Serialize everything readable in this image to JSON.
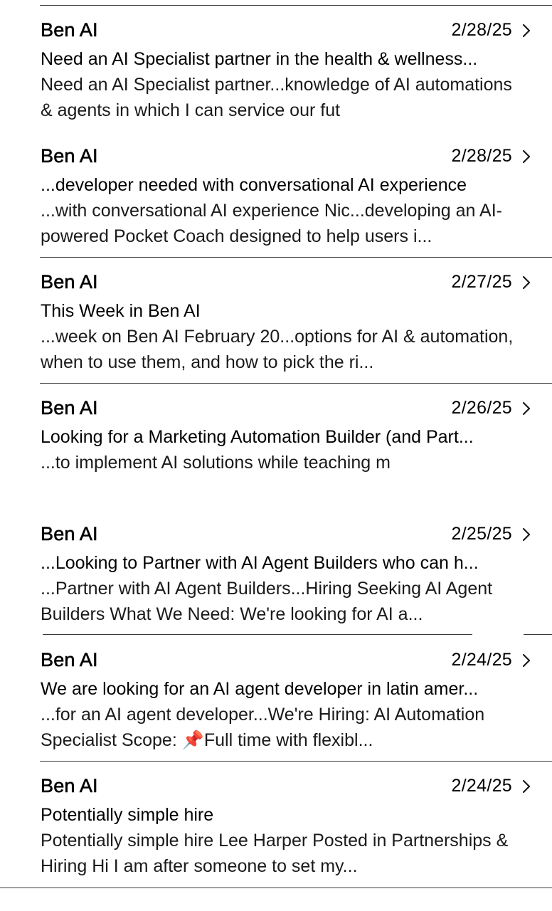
{
  "messages": [
    {
      "sender": "Ben AI",
      "date": "2/28/25",
      "subject": "Need an AI Specialist partner in the health & wellness...",
      "preview": "Need an AI Specialist partner...knowledge of AI automations & agents in which I can service our fut"
    },
    {
      "sender": "Ben AI",
      "date": "2/28/25",
      "subject": "...developer needed with conversational AI experience",
      "preview": "...with conversational AI experience Nic...developing an AI-powered Pocket Coach designed to help users i..."
    },
    {
      "sender": "Ben AI",
      "date": "2/27/25",
      "subject": "This Week in Ben AI",
      "preview": "...week on Ben AI February 20...options for AI & automation, when to use them, and how to pick the ri..."
    },
    {
      "sender": "Ben AI",
      "date": "2/26/25",
      "subject": "Looking for a Marketing Automation Builder (and Part...",
      "preview": "...to implement AI solutions while teaching m"
    },
    {
      "sender": "Ben AI",
      "date": "2/25/25",
      "subject": "...Looking to Partner with AI Agent Builders who can h...",
      "preview": "...Partner with AI Agent Builders...Hiring Seeking AI Agent Builders What We Need: We're looking for AI a..."
    },
    {
      "sender": "Ben AI",
      "date": "2/24/25",
      "subject": "We are looking for an AI agent developer in latin amer...",
      "preview": "...for an AI agent developer...We're Hiring: AI Automation Specialist Scope: 📌Full time with flexibl..."
    },
    {
      "sender": "Ben AI",
      "date": "2/24/25",
      "subject": "Potentially simple hire",
      "preview": "Potentially simple hire Lee Harper Posted in Partnerships & Hiring Hi I am after someone to set my..."
    }
  ],
  "icons": {
    "chevron": "chevron-right-icon"
  },
  "colors": {
    "divider": "#3a3a3a",
    "text": "#000000"
  }
}
